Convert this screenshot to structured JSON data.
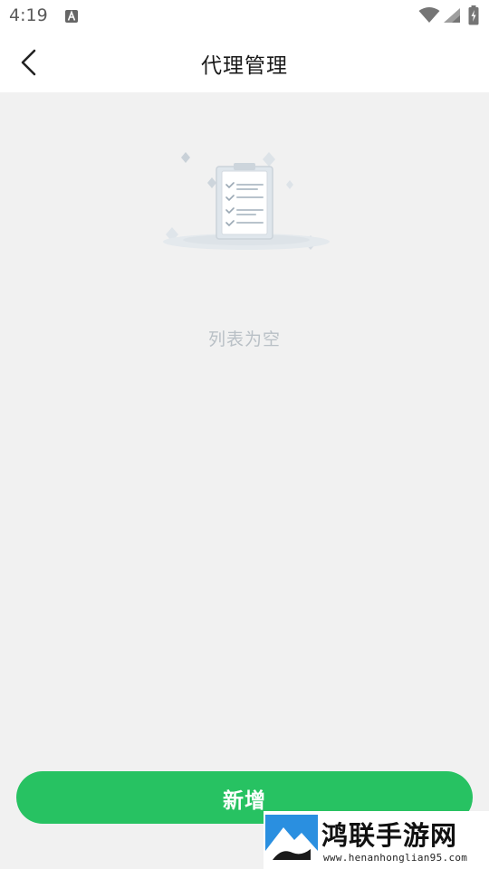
{
  "status_bar": {
    "time": "4:19",
    "icons": [
      "a-notification-icon",
      "wifi-icon",
      "signal-icon",
      "battery-icon"
    ]
  },
  "header": {
    "title": "代理管理",
    "back_icon": "chevron-left-icon"
  },
  "main": {
    "empty_icon": "clipboard-checklist-icon",
    "empty_text": "列表为空"
  },
  "footer": {
    "add_label": "新增"
  },
  "watermark": {
    "name": "鸿联手游网",
    "url": "www.henanhonglian95.com"
  },
  "colors": {
    "accent": "#27c262",
    "background": "#f1f1f1",
    "header_bg": "#ffffff",
    "empty_text": "#b9c0c6"
  }
}
